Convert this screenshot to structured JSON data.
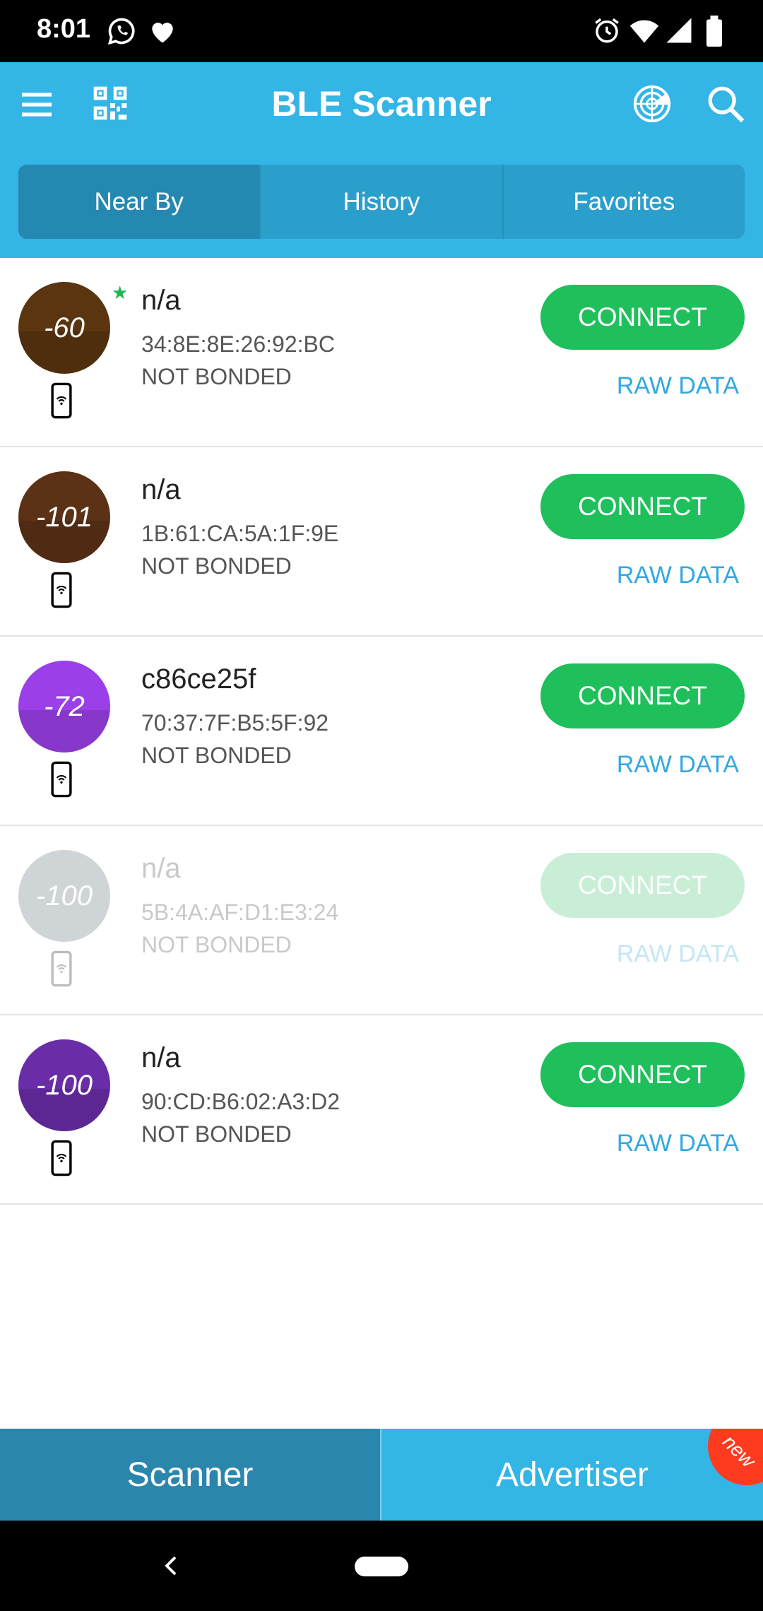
{
  "status_bar": {
    "time": "8:01",
    "left_icons": [
      "whatsapp-icon",
      "heart-icon"
    ],
    "right_icons": [
      "alarm-icon",
      "wifi-icon",
      "signal-icon",
      "battery-icon"
    ]
  },
  "app_bar": {
    "title": "BLE Scanner",
    "icons": [
      "menu-icon",
      "qr-code-icon",
      "radar-icon",
      "search-icon"
    ]
  },
  "tabs": [
    {
      "label": "Near By",
      "active": true
    },
    {
      "label": "History",
      "active": false
    },
    {
      "label": "Favorites",
      "active": false
    }
  ],
  "devices": [
    {
      "rssi": "-60",
      "name": "n/a",
      "mac": "34:8E:8E:26:92:BC",
      "bond": "NOT BONDED",
      "connect": "CONNECT",
      "raw": "RAW DATA",
      "color": "#5a3510",
      "favorite": true,
      "active": true
    },
    {
      "rssi": "-101",
      "name": "n/a",
      "mac": "1B:61:CA:5A:1F:9E",
      "bond": "NOT BONDED",
      "connect": "CONNECT",
      "raw": "RAW DATA",
      "color": "#5c3216",
      "favorite": false,
      "active": true
    },
    {
      "rssi": "-72",
      "name": "c86ce25f",
      "mac": "70:37:7F:B5:5F:92",
      "bond": "NOT BONDED",
      "connect": "CONNECT",
      "raw": "RAW DATA",
      "color": "#9b3fe8",
      "favorite": false,
      "active": true
    },
    {
      "rssi": "-100",
      "name": "n/a",
      "mac": "5B:4A:AF:D1:E3:24",
      "bond": "NOT BONDED",
      "connect": "CONNECT",
      "raw": "RAW DATA",
      "color": "#cfd4d6",
      "favorite": false,
      "active": false
    },
    {
      "rssi": "-100",
      "name": "n/a",
      "mac": "90:CD:B6:02:A3:D2",
      "bond": "NOT BONDED",
      "connect": "CONNECT",
      "raw": "RAW DATA",
      "color": "#6a2da8",
      "favorite": false,
      "active": true
    }
  ],
  "bottom_bar": {
    "scanner": "Scanner",
    "advertiser": "Advertiser",
    "new_badge": "new"
  },
  "colors": {
    "primary": "#33b5e5",
    "connect": "#1fbf5b",
    "raw_link": "#33a8e0"
  }
}
